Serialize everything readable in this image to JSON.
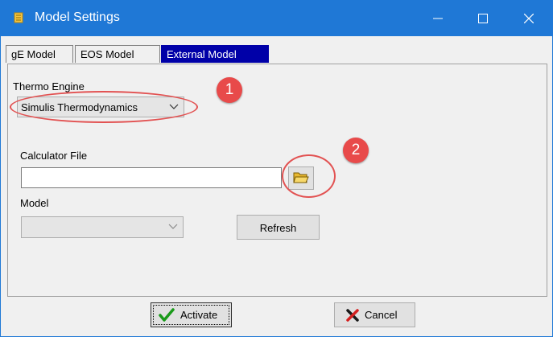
{
  "window": {
    "title": "Model Settings"
  },
  "tabs": [
    {
      "label": "gE Model",
      "active": false
    },
    {
      "label": "EOS Model",
      "active": false
    },
    {
      "label": "External Model",
      "active": true
    }
  ],
  "thermo_engine": {
    "label": "Thermo Engine",
    "selected": "Simulis Thermodynamics",
    "annotation_number": "1"
  },
  "calculator_file": {
    "label": "Calculator File",
    "value": "",
    "annotation_number": "2",
    "browse_icon": "folder-open-icon"
  },
  "model": {
    "label": "Model",
    "selected": "",
    "refresh_label": "Refresh"
  },
  "footer": {
    "activate_label": "Activate",
    "cancel_label": "Cancel"
  },
  "colors": {
    "titlebar": "#1f78d6",
    "active_tab": "#0000a8",
    "annotation": "#e84a4a"
  }
}
